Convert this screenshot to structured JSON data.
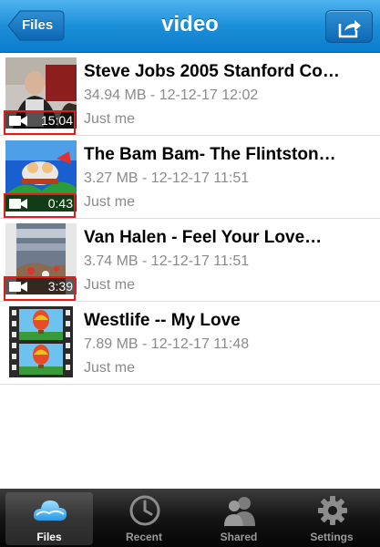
{
  "header": {
    "title": "video",
    "back_label": "Files",
    "share_icon": "share-icon"
  },
  "files": [
    {
      "title": "Steve Jobs 2005 Stanford Co…",
      "meta": "34.94 MB - 12-12-17 12:02",
      "share": "Just me",
      "duration": "15:04",
      "thumbnail": "video-thumbnail"
    },
    {
      "title": "The Bam Bam- The Flintston…",
      "meta": "3.27 MB - 12-12-17 11:51",
      "share": "Just me",
      "duration": "0:43",
      "thumbnail": "video-thumbnail"
    },
    {
      "title": "Van Halen - Feel Your Love…",
      "meta": "3.74 MB - 12-12-17 11:51",
      "share": "Just me",
      "duration": "3:39",
      "thumbnail": "video-thumbnail"
    },
    {
      "title": "Westlife -- My Love",
      "meta": "7.89 MB - 12-12-17 11:48",
      "share": "Just me",
      "thumbnail": "film-strip-icon"
    }
  ],
  "tabbar": {
    "tabs": [
      {
        "label": "Files",
        "icon": "cloud-icon",
        "active": true
      },
      {
        "label": "Recent",
        "icon": "clock-icon",
        "active": false
      },
      {
        "label": "Shared",
        "icon": "people-icon",
        "active": false
      },
      {
        "label": "Settings",
        "icon": "gear-icon",
        "active": false
      }
    ]
  },
  "colors": {
    "accent": "#1c8fd9",
    "highlight": "#e31b1b",
    "secondary_text": "#8a8a8a"
  }
}
